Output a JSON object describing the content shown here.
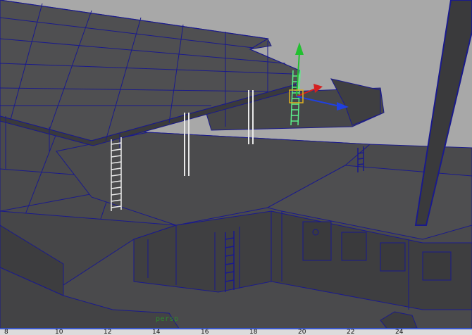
{
  "viewport": {
    "camera_label": "persp"
  },
  "timeline": {
    "ticks": [
      "8",
      "10",
      "12",
      "14",
      "16",
      "18",
      "20",
      "22",
      "24"
    ]
  },
  "colors": {
    "background": "#a8a8a8",
    "geometry_fill": "#4d4d4f",
    "geometry_dark": "#3f3f41",
    "wireframe": "#1a1a8c",
    "selected_ladder": "#5cf08a",
    "pivot": "#e0b020",
    "axis_y": "#22c030",
    "axis_x": "#d42020",
    "axis_z": "#2040e0"
  },
  "icons": [
    "move-manipulator-icon"
  ]
}
